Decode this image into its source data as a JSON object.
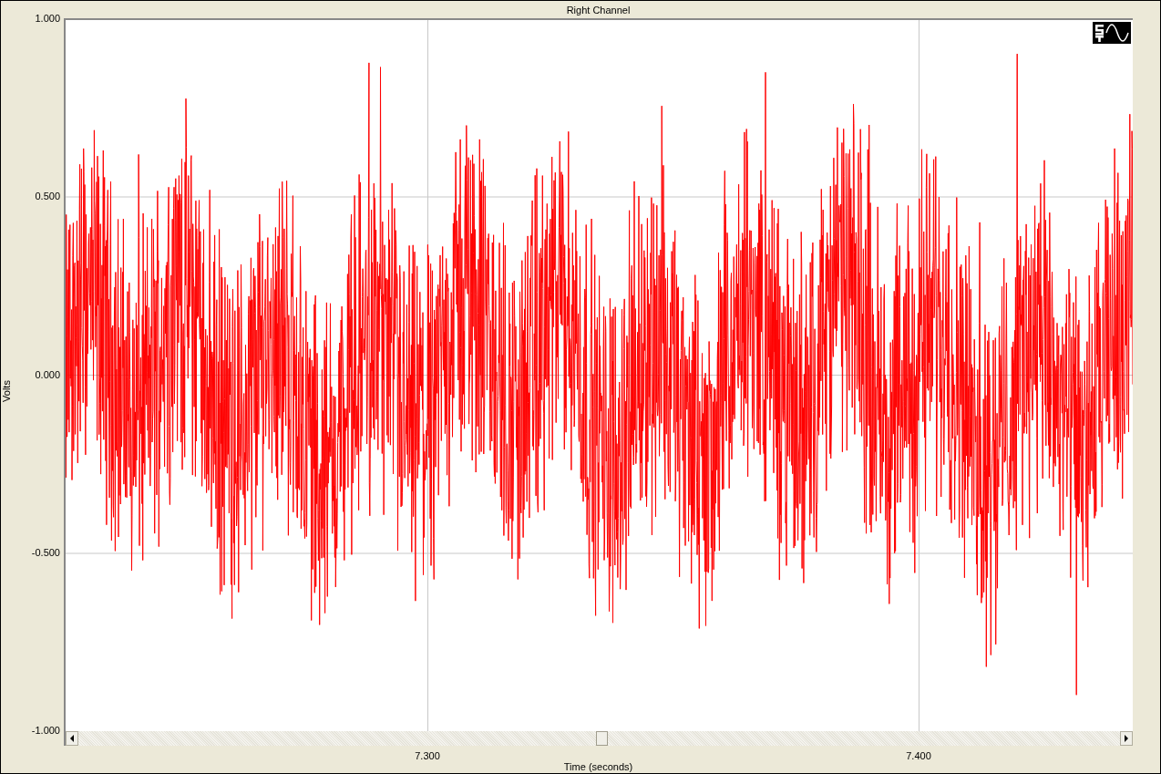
{
  "chart": {
    "title": "Right Channel",
    "ylabel": "Volts",
    "xlabel": "Time (seconds)",
    "y_ticks": [
      "1.000",
      "0.500",
      "0.000",
      "-0.500",
      "-1.000"
    ],
    "x_ticks": [
      "7.300",
      "7.400"
    ]
  }
}
